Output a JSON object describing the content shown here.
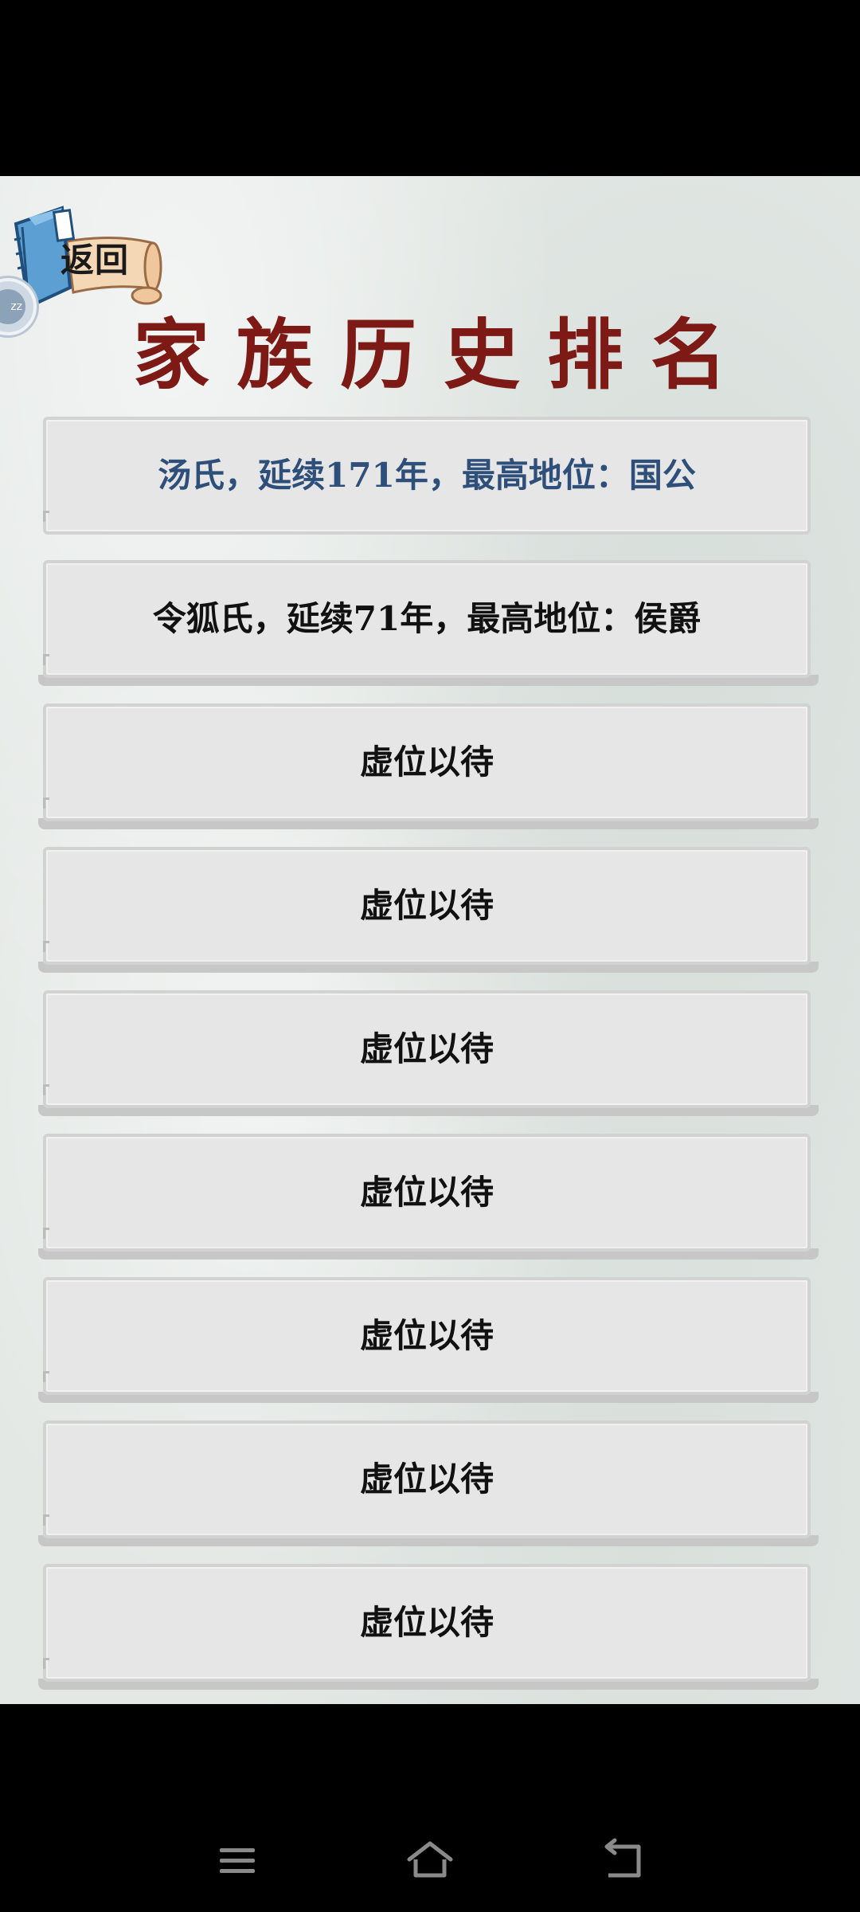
{
  "header": {
    "back_label": "返回",
    "title": "家族历史排名"
  },
  "ranking": [
    {
      "text": "汤氏，延续171年，最高地位：国公"
    },
    {
      "text": "令狐氏，延续71年，最高地位：侯爵"
    },
    {
      "text": "虚位以待"
    },
    {
      "text": "虚位以待"
    },
    {
      "text": "虚位以待"
    },
    {
      "text": "虚位以待"
    },
    {
      "text": "虚位以待"
    },
    {
      "text": "虚位以待"
    },
    {
      "text": "虚位以待"
    }
  ],
  "floating_ball": {
    "label": "zz"
  },
  "icons": {
    "back": "book-scroll-icon",
    "menu": "menu-icon",
    "home": "home-icon",
    "back_nav": "back-arrow-icon"
  },
  "colors": {
    "title": "#7e1a16",
    "highlight_entry": "#2e4f7a",
    "background": "#e3e8e5",
    "card": "#e6e6e6"
  }
}
